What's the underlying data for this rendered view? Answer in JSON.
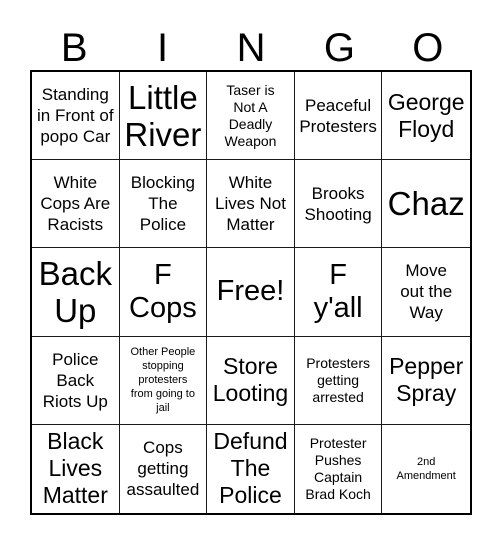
{
  "card": {
    "title": "BINGO",
    "header_letters": [
      "B",
      "I",
      "N",
      "G",
      "O"
    ],
    "free_space_label": "Free!",
    "rows": 5,
    "columns": 5,
    "text_color": "#000000",
    "background_color": "#ffffff",
    "border_color": "#1a1a1a",
    "cells": [
      {
        "text": "Standing\nin Front of\npopo Car",
        "size": "sz-sm",
        "free": false
      },
      {
        "text": "Little\nRiver",
        "size": "sz-xl",
        "free": false
      },
      {
        "text": "Taser is\nNot A\nDeadly\nWeapon",
        "size": "sz-xs",
        "free": false
      },
      {
        "text": "Peaceful\nProtesters",
        "size": "sz-sm",
        "free": false
      },
      {
        "text": "George\nFloyd",
        "size": "sz-md",
        "free": false
      },
      {
        "text": "White\nCops Are\nRacists",
        "size": "sz-sm",
        "free": false
      },
      {
        "text": "Blocking\nThe\nPolice",
        "size": "sz-sm",
        "free": false
      },
      {
        "text": "White\nLives Not\nMatter",
        "size": "sz-sm",
        "free": false
      },
      {
        "text": "Brooks\nShooting",
        "size": "sz-sm",
        "free": false
      },
      {
        "text": "Chaz",
        "size": "sz-xl",
        "free": false
      },
      {
        "text": "Back\nUp",
        "size": "sz-xl",
        "free": false
      },
      {
        "text": "F\nCops",
        "size": "sz-lg",
        "free": false
      },
      {
        "text": "Free!",
        "size": "sz-lg",
        "free": true
      },
      {
        "text": "F\ny'all",
        "size": "sz-lg",
        "free": false
      },
      {
        "text": "Move\nout the\nWay",
        "size": "sz-sm",
        "free": false
      },
      {
        "text": "Police\nBack\nRiots Up",
        "size": "sz-sm",
        "free": false
      },
      {
        "text": "Other People\nstopping\nprotesters\nfrom going to\njail",
        "size": "sz-xxs",
        "free": false
      },
      {
        "text": "Store\nLooting",
        "size": "sz-md",
        "free": false
      },
      {
        "text": "Protesters\ngetting\narrested",
        "size": "sz-xs",
        "free": false
      },
      {
        "text": "Pepper\nSpray",
        "size": "sz-md",
        "free": false
      },
      {
        "text": "Black\nLives\nMatter",
        "size": "sz-md",
        "free": false
      },
      {
        "text": "Cops\ngetting\nassaulted",
        "size": "sz-sm",
        "free": false
      },
      {
        "text": "Defund\nThe\nPolice",
        "size": "sz-md",
        "free": false
      },
      {
        "text": "Protester\nPushes\nCaptain\nBrad Koch",
        "size": "sz-xs",
        "free": false
      },
      {
        "text": "2nd\nAmendment",
        "size": "sz-xxs",
        "free": false
      }
    ]
  }
}
